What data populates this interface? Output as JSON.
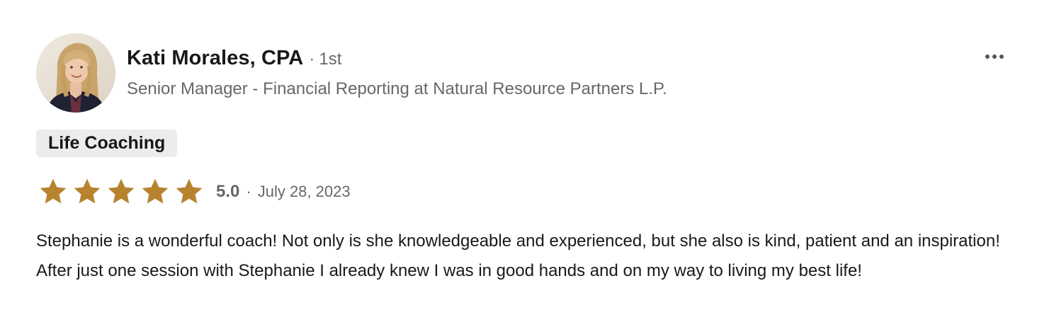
{
  "reviewer": {
    "name": "Kati Morales, CPA",
    "separator": "·",
    "connection_degree": "1st",
    "headline": "Senior Manager - Financial Reporting at Natural Resource Partners L.P.",
    "avatar_icon": "profile-photo"
  },
  "menu": {
    "icon": "more-horizontal-icon"
  },
  "service_tag": "Life Coaching",
  "rating": {
    "value": 5,
    "max": 5,
    "score_label": "5.0",
    "separator": "·",
    "date": "July 28, 2023",
    "star_color": "#b7832f",
    "star_icon": "star-icon"
  },
  "review_text": "Stephanie is a wonderful coach! Not only is she knowledgeable and experienced, but she also is kind, patient and an inspiration! After just one session with Stephanie I already knew I was in good hands and on my way to living my best life!"
}
